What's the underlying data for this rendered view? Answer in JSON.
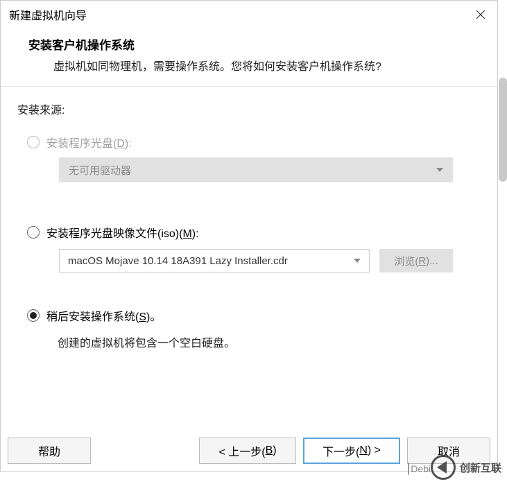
{
  "titlebar": {
    "title": "新建虚拟机向导"
  },
  "header": {
    "title": "安装客户机操作系统",
    "desc": "虚拟机如同物理机，需要操作系统。您将如何安装客户机操作系统?"
  },
  "body": {
    "section_label": "安装来源:",
    "opt_disc": {
      "prefix": "安装程序光盘(",
      "hotkey": "D",
      "suffix": "):"
    },
    "disc_dropdown": "无可用驱动器",
    "opt_iso": {
      "prefix": "安装程序光盘映像文件(iso)(",
      "hotkey": "M",
      "suffix": "):"
    },
    "iso_value": "macOS Mojave 10.14 18A391 Lazy Installer.cdr",
    "browse": {
      "prefix": "浏览(",
      "hotkey": "R",
      "suffix": ")..."
    },
    "opt_later": {
      "prefix": "稍后安装操作系统(",
      "hotkey": "S",
      "suffix": ")。"
    },
    "later_hint": "创建的虚拟机将包含一个空白硬盘。"
  },
  "footer": {
    "help": "帮助",
    "back": {
      "prefix": "< 上一步(",
      "hotkey": "B",
      "suffix": ")"
    },
    "next": {
      "prefix": "下一步(",
      "hotkey": "N",
      "suffix": ") >"
    },
    "cancel": "取消"
  },
  "watermark": {
    "debi": "Debi",
    "brand": "创新互联"
  }
}
